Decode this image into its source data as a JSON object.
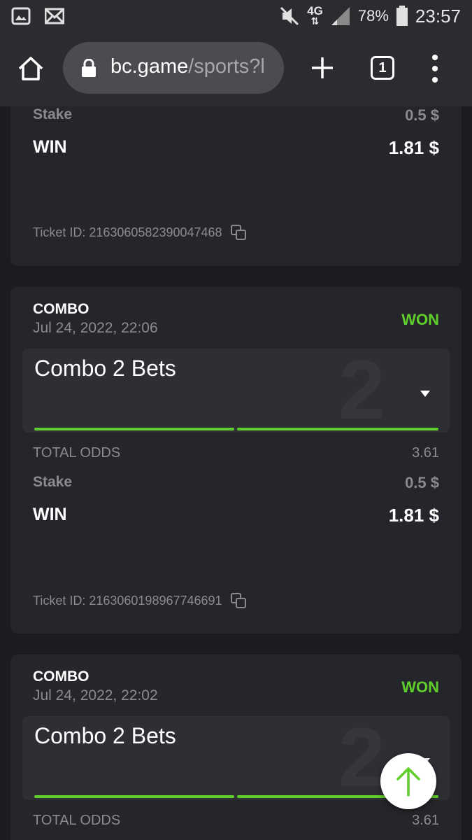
{
  "status_bar": {
    "network": "4G",
    "battery": "78%",
    "time": "23:57",
    "icons": [
      "gallery-icon",
      "mail-icon",
      "mute-icon",
      "signal-icon",
      "battery-icon"
    ]
  },
  "browser": {
    "url_host": "bc.game",
    "url_path": "/sports?l",
    "tab_count": "1"
  },
  "tickets": [
    {
      "stake_label": "Stake",
      "stake_value": "0.5 $",
      "win_label": "WIN",
      "win_value": "1.81 $",
      "ticket_id": "Ticket ID: 2163060582390047468"
    },
    {
      "type": "COMBO",
      "date": "Jul 24, 2022, 22:06",
      "status": "WON",
      "combo_name": "Combo 2 Bets",
      "combo_count": "2",
      "total_odds_label": "TOTAL ODDS",
      "total_odds_value": "3.61",
      "stake_label": "Stake",
      "stake_value": "0.5 $",
      "win_label": "WIN",
      "win_value": "1.81 $",
      "ticket_id": "Ticket ID: 2163060198967746691"
    },
    {
      "type": "COMBO",
      "date": "Jul 24, 2022, 22:02",
      "status": "WON",
      "combo_name": "Combo 2 Bets",
      "combo_count": "2",
      "total_odds_label": "TOTAL ODDS",
      "total_odds_value": "3.61"
    }
  ],
  "colors": {
    "accent_green": "#5fce2b",
    "card_bg": "#25262b",
    "page_bg": "#1a1c20"
  }
}
